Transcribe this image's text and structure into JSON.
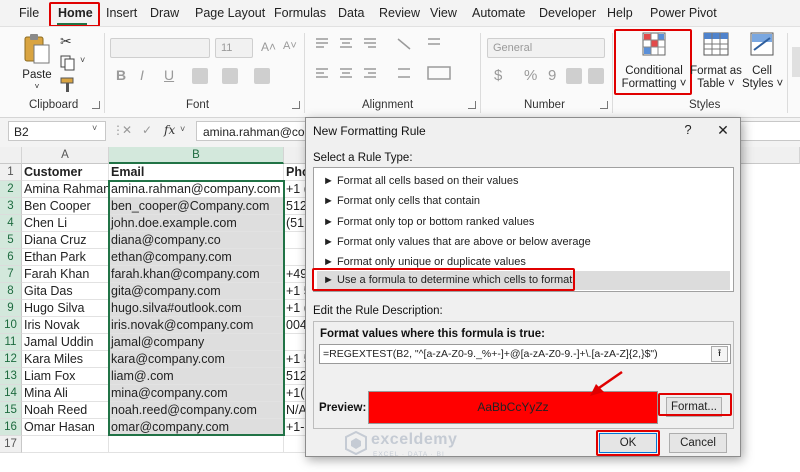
{
  "ribbon_tabs": [
    "File",
    "Home",
    "Insert",
    "Draw",
    "Page Layout",
    "Formulas",
    "Data",
    "Review",
    "View",
    "Automate",
    "Developer",
    "Help",
    "Power Pivot"
  ],
  "ribbon": {
    "clipboard": {
      "paste": "Paste",
      "label": "Clipboard"
    },
    "font": {
      "size": "11",
      "bold": "B",
      "italic": "I",
      "underline": "U",
      "label": "Font"
    },
    "alignment": {
      "label": "Alignment"
    },
    "number": {
      "format": "General",
      "currency": "$",
      "percent": "%",
      "comma": "9",
      "label": "Number"
    },
    "styles": {
      "conditional_formatting_l1": "Conditional",
      "conditional_formatting_l2": "Formatting ˅",
      "format_as_table_l1": "Format as",
      "format_as_table_l2": "Table ˅",
      "cell_styles_l1": "Cell",
      "cell_styles_l2": "Styles ˅",
      "label": "Styles"
    }
  },
  "formula_bar": {
    "name_box": "B2",
    "cancel": "✕",
    "enter": "✓",
    "fx": "fx",
    "value": "amina.rahman@co"
  },
  "sheet": {
    "columns": [
      "A",
      "B"
    ],
    "rows": [
      "1",
      "2",
      "3",
      "4",
      "5",
      "6",
      "7",
      "8",
      "9",
      "10",
      "11",
      "12",
      "13",
      "14",
      "15",
      "16",
      "17"
    ],
    "headers": {
      "customer": "Customer",
      "email": "Email",
      "phone": "Pho"
    },
    "data": [
      {
        "customer": "Amina Rahman",
        "email": "amina.rahman@company.com",
        "phone": "+1 ("
      },
      {
        "customer": "Ben Cooper",
        "email": "ben_cooper@Company.com",
        "phone": "512"
      },
      {
        "customer": "Chen Li",
        "email": "john.doe.example.com",
        "phone": "(51"
      },
      {
        "customer": "Diana Cruz",
        "email": "diana@company.co",
        "phone": ""
      },
      {
        "customer": "Ethan Park",
        "email": "ethan@company.com",
        "phone": ""
      },
      {
        "customer": "Farah Khan",
        "email": "farah.khan@company.com",
        "phone": "+49"
      },
      {
        "customer": "Gita Das",
        "email": "gita@company.com",
        "phone": "+1 5"
      },
      {
        "customer": "Hugo Silva",
        "email": "hugo.silva#outlook.com",
        "phone": "+1 ("
      },
      {
        "customer": "Iris Novak",
        "email": "iris.novak@company.com",
        "phone": "004"
      },
      {
        "customer": "Jamal Uddin",
        "email": "jamal@company",
        "phone": ""
      },
      {
        "customer": "Kara Miles",
        "email": "kara@company.com",
        "phone": "+1 5"
      },
      {
        "customer": "Liam Fox",
        "email": "liam@.com",
        "phone": "512"
      },
      {
        "customer": "Mina Ali",
        "email": "mina@company.com",
        "phone": "+1(5"
      },
      {
        "customer": "Noah Reed",
        "email": "noah.reed@company.com",
        "phone": "N/A"
      },
      {
        "customer": "Omar Hasan",
        "email": "omar@company.com",
        "phone": "+1-5"
      }
    ]
  },
  "dialog": {
    "title": "New Formatting Rule",
    "help": "?",
    "close": "✕",
    "select_rule_type": "Select a Rule Type:",
    "rule_types": [
      "► Format all cells based on their values",
      "► Format only cells that contain",
      "► Format only top or bottom ranked values",
      "► Format only values that are above or below average",
      "► Format only unique or duplicate values",
      "► Use a formula to determine which cells to format"
    ],
    "edit_description": "Edit the Rule Description:",
    "formula_label": "Format values where this formula is true:",
    "formula": "=REGEXTEST(B2, \"^[a-zA-Z0-9._%+-]+@[a-zA-Z0-9.-]+\\.[a-zA-Z]{2,}$\")",
    "preview_label": "Preview:",
    "preview_text": "AaBbCcYyZz",
    "preview_color": "#ff0000",
    "format_button": "Format...",
    "ok_button": "OK",
    "cancel_button": "Cancel"
  },
  "watermark": {
    "name": "exceldemy",
    "tagline": "EXCEL · DATA · BI"
  },
  "colors": {
    "excel_green": "#217346",
    "highlight_red": "#e00000"
  }
}
